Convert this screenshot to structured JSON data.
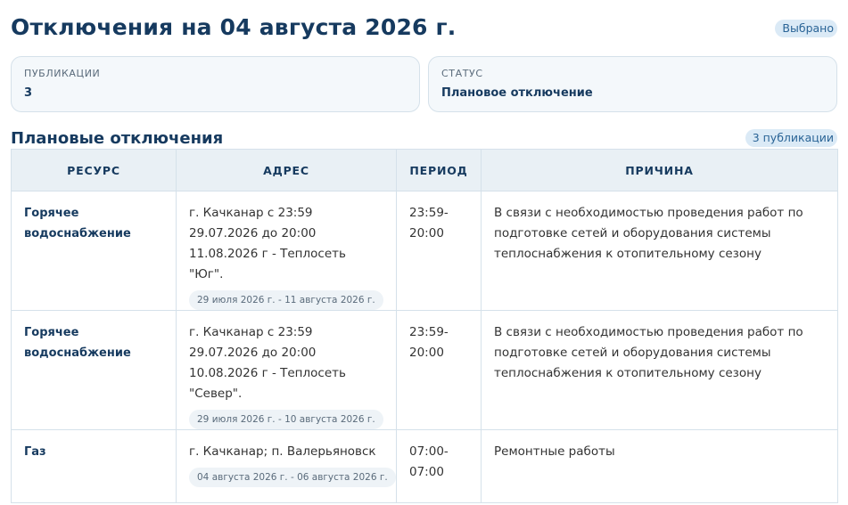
{
  "header": {
    "title": "Отключения на 04 августа 2026 г.",
    "selected_badge": "Выбрано"
  },
  "summary": {
    "publications_label": "ПУБЛИКАЦИИ",
    "publications_value": "3",
    "status_label": "СТАТУС",
    "status_value": "Плановое отключение"
  },
  "section": {
    "title": "Плановые отключения",
    "count_badge": "3 публикации"
  },
  "table": {
    "columns": [
      "РЕСУРС",
      "АДРЕС",
      "ПЕРИОД",
      "ПРИЧИНА"
    ],
    "rows": [
      {
        "resource": "Горячее водоснабжение",
        "address": "г. Качканар с 23:59 29.07.2026 до 20:00 11.08.2026 г - Теплосеть \"Юг\".",
        "date_range": "29 июля 2026 г. - 11 августа 2026 г.",
        "period": "23:59-20:00",
        "reason": "В связи с необходимостью проведения работ по подготовке сетей и оборудования системы теплоснабжения к отопительному сезону"
      },
      {
        "resource": "Горячее водоснабжение",
        "address": "г. Качканар с 23:59 29.07.2026 до 20:00 10.08.2026 г - Теплосеть \"Север\".",
        "date_range": "29 июля 2026 г. - 10 августа 2026 г.",
        "period": "23:59-20:00",
        "reason": "В связи с необходимостью проведения работ по подготовке сетей и оборудования системы теплоснабжения к отопительному сезону"
      },
      {
        "resource": "Газ",
        "address": "г. Качканар; п. Валерьяновск",
        "date_range": "04 августа 2026 г. - 06 августа 2026 г.",
        "period": "07:00-07:00",
        "reason": "Ремонтные работы"
      }
    ]
  }
}
